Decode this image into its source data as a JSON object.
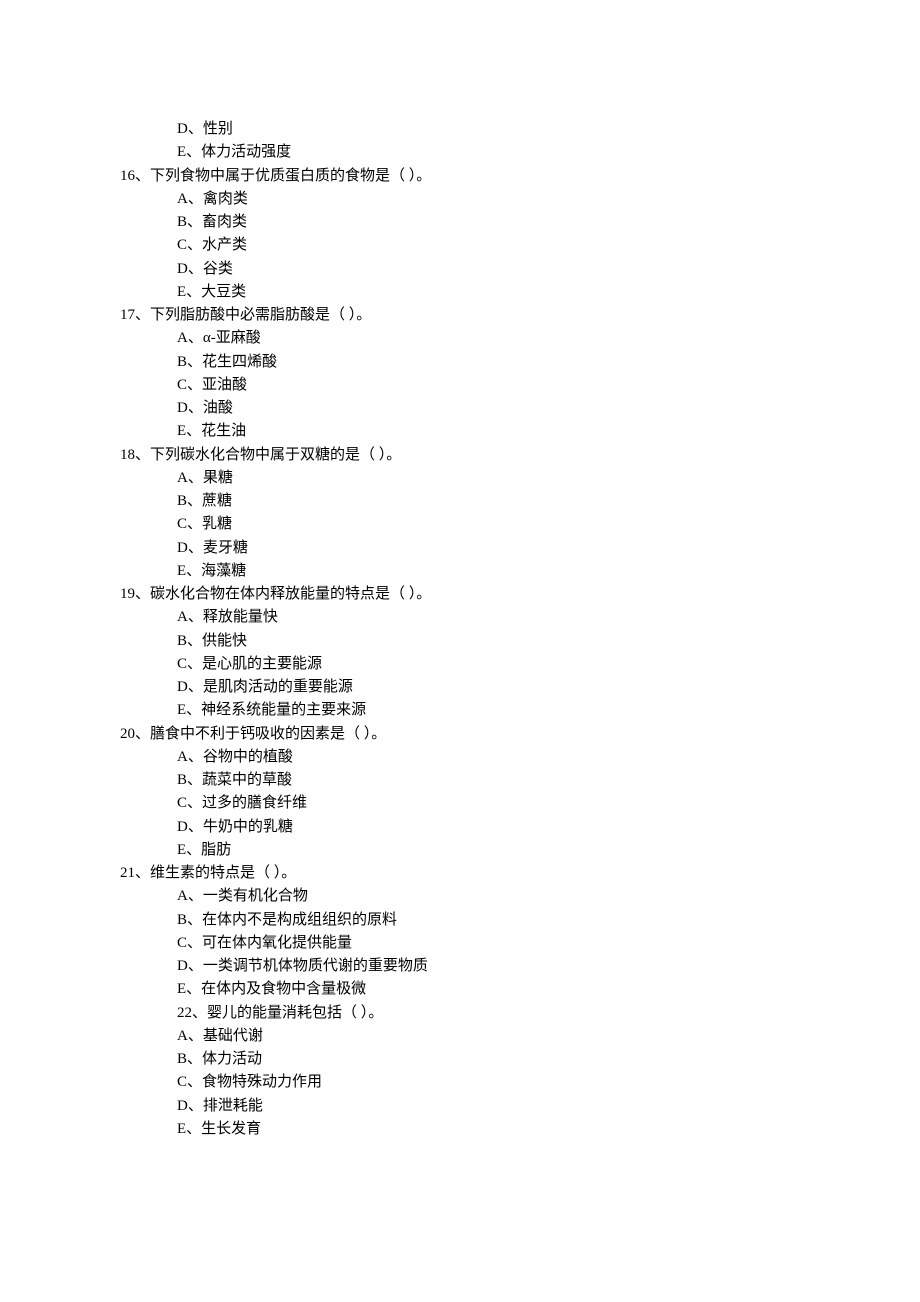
{
  "blank": "（      ）。",
  "q15_tail": {
    "options": [
      {
        "key": "D、",
        "text": "性别"
      },
      {
        "key": "E、",
        "text": "体力活动强度"
      }
    ]
  },
  "q16": {
    "num": "16、",
    "stem": "下列食物中属于优质蛋白质的食物是",
    "options": [
      {
        "key": "A、",
        "text": "禽肉类"
      },
      {
        "key": "B、",
        "text": "畜肉类"
      },
      {
        "key": "C、",
        "text": "水产类"
      },
      {
        "key": "D、",
        "text": "谷类"
      },
      {
        "key": "E、",
        "text": "大豆类"
      }
    ]
  },
  "q17": {
    "num": "17、",
    "stem": "下列脂肪酸中必需脂肪酸是",
    "options": [
      {
        "key": "A、",
        "text": "α-亚麻酸"
      },
      {
        "key": "B、",
        "text": "花生四烯酸"
      },
      {
        "key": "C、",
        "text": "亚油酸"
      },
      {
        "key": "D、",
        "text": "油酸"
      },
      {
        "key": "E、",
        "text": "花生油"
      }
    ]
  },
  "q18": {
    "num": "18、",
    "stem": "下列碳水化合物中属于双糖的是",
    "options": [
      {
        "key": "A、",
        "text": "果糖"
      },
      {
        "key": "B、",
        "text": "蔗糖"
      },
      {
        "key": "C、",
        "text": "乳糖"
      },
      {
        "key": "D、",
        "text": "麦牙糖"
      },
      {
        "key": "E、",
        "text": "海藻糖"
      }
    ]
  },
  "q19": {
    "num": "19、",
    "stem": "碳水化合物在体内释放能量的特点是",
    "options": [
      {
        "key": "A、",
        "text": "释放能量快"
      },
      {
        "key": "B、",
        "text": "供能快"
      },
      {
        "key": "C、",
        "text": "是心肌的主要能源"
      },
      {
        "key": "D、",
        "text": "是肌肉活动的重要能源"
      },
      {
        "key": "E、",
        "text": "神经系统能量的主要来源"
      }
    ]
  },
  "q20": {
    "num": "20、",
    "stem": "膳食中不利于钙吸收的因素是",
    "options": [
      {
        "key": "A、",
        "text": "谷物中的植酸"
      },
      {
        "key": "B、",
        "text": "蔬菜中的草酸"
      },
      {
        "key": "C、",
        "text": "过多的膳食纤维"
      },
      {
        "key": "D、",
        "text": "牛奶中的乳糖"
      },
      {
        "key": "E、",
        "text": "脂肪"
      }
    ]
  },
  "q21": {
    "num": "21、",
    "stem": "维生素的特点是",
    "options": [
      {
        "key": "A、",
        "text": "一类有机化合物"
      },
      {
        "key": "B、",
        "text": "在体内不是构成组组织的原料"
      },
      {
        "key": "C、",
        "text": "可在体内氧化提供能量"
      },
      {
        "key": "D、",
        "text": "一类调节机体物质代谢的重要物质"
      },
      {
        "key": "E、",
        "text": "在体内及食物中含量极微"
      }
    ]
  },
  "q22": {
    "num": "22、",
    "stem": "婴儿的能量消耗包括",
    "options": [
      {
        "key": "A、",
        "text": "基础代谢"
      },
      {
        "key": "B、",
        "text": "体力活动"
      },
      {
        "key": "C、",
        "text": "食物特殊动力作用"
      },
      {
        "key": "D、",
        "text": "排泄耗能"
      },
      {
        "key": "E、",
        "text": "生长发育"
      }
    ]
  }
}
